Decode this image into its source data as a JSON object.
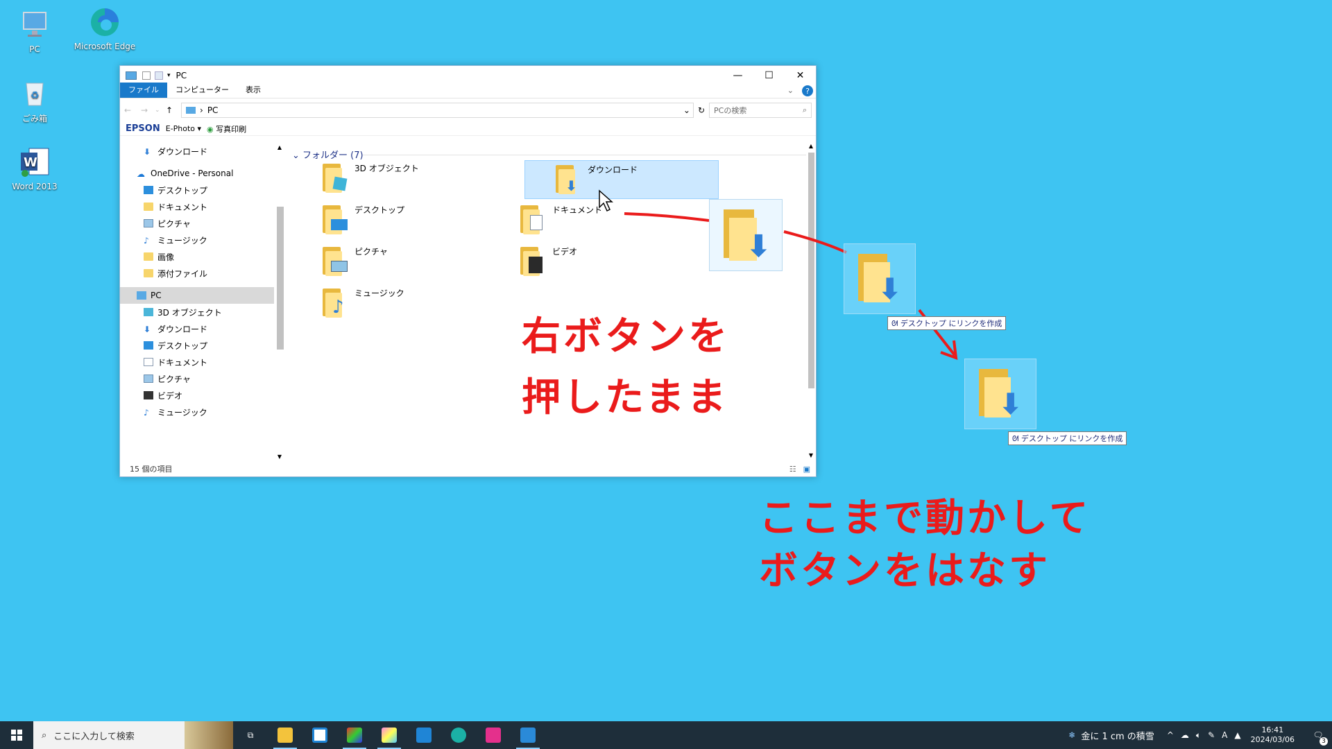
{
  "desktop": {
    "icons": [
      {
        "label": "PC"
      },
      {
        "label": "Microsoft Edge"
      },
      {
        "label": "ごみ箱"
      },
      {
        "label": "Word 2013"
      }
    ]
  },
  "window": {
    "title": "PC",
    "ribbon_tabs": [
      "ファイル",
      "コンピューター",
      "表示"
    ],
    "address": "PC",
    "search_placeholder": "PCの検索",
    "epson": {
      "brand": "EPSON",
      "app": "E-Photo",
      "print": "写真印刷"
    },
    "nav": {
      "items": [
        {
          "label": "ダウンロード"
        },
        {
          "label": "OneDrive - Personal"
        },
        {
          "label": "デスクトップ"
        },
        {
          "label": "ドキュメント"
        },
        {
          "label": "ピクチャ"
        },
        {
          "label": "ミュージック"
        },
        {
          "label": "画像"
        },
        {
          "label": "添付ファイル"
        },
        {
          "label": "PC"
        },
        {
          "label": "3D オブジェクト"
        },
        {
          "label": "ダウンロード"
        },
        {
          "label": "デスクトップ"
        },
        {
          "label": "ドキュメント"
        },
        {
          "label": "ピクチャ"
        },
        {
          "label": "ビデオ"
        },
        {
          "label": "ミュージック"
        }
      ]
    },
    "group_header": "フォルダー (7)",
    "folders": [
      {
        "label": "3D オブジェクト"
      },
      {
        "label": "ダウンロード"
      },
      {
        "label": "デスクトップ"
      },
      {
        "label": "ドキュメント"
      },
      {
        "label": "ピクチャ"
      },
      {
        "label": "ビデオ"
      },
      {
        "label": "ミュージック"
      }
    ],
    "status": "15 個の項目"
  },
  "annotations": {
    "line1": "右ボタンを",
    "line2": "押したまま",
    "line3": "ここまで動かして",
    "line4": "ボタンをはなす",
    "drag_tip": "デスクトップ にリンクを作成",
    "arrow_color": "#ea1b1b"
  },
  "taskbar": {
    "search_placeholder": "ここに入力して検索",
    "weather": "金に 1 cm の積雪",
    "time": "16:41",
    "date": "2024/03/06",
    "notification_count": "3"
  }
}
